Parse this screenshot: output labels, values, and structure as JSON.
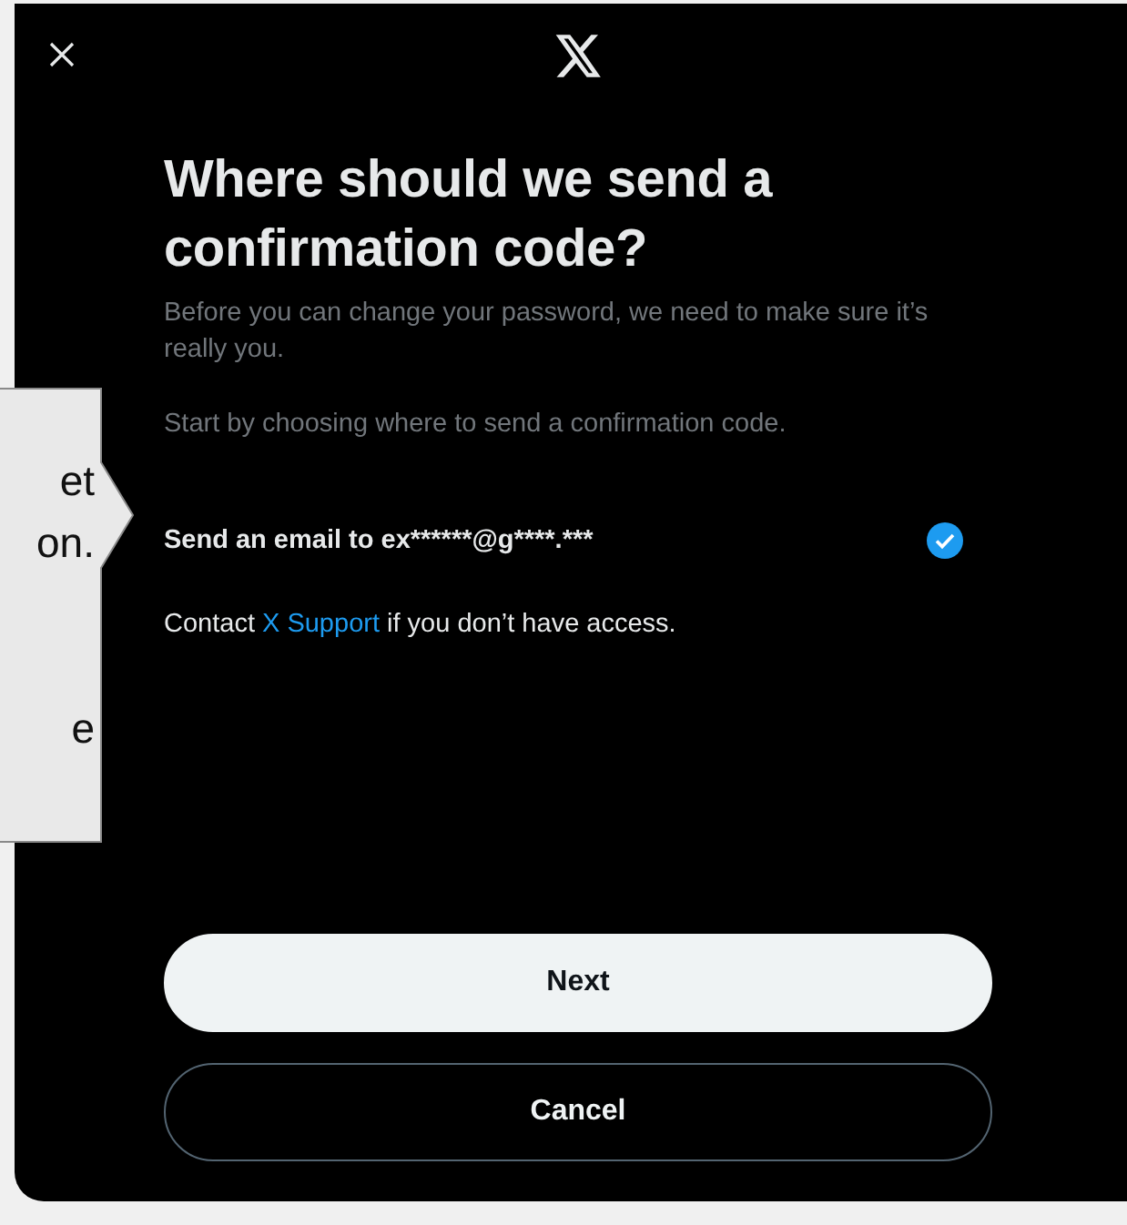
{
  "callout": {
    "paragraphs": [
      [
        "et",
        "on."
      ],
      [
        "e"
      ]
    ]
  },
  "dialog": {
    "title": "Where should we send a confirmation code?",
    "description": "Before you can change your password, we need to make sure it’s really you.",
    "instruction": "Start by choosing where to send a confirmation code.",
    "options": [
      {
        "label": "Send an email to ex******@g****.***",
        "selected": true
      }
    ],
    "contact": {
      "before": "Contact",
      "link": "X Support",
      "after": "if you don’t have access."
    },
    "buttons": [
      {
        "label": "Next",
        "kind": "primary"
      },
      {
        "label": "Cancel",
        "kind": "secondary"
      }
    ]
  }
}
